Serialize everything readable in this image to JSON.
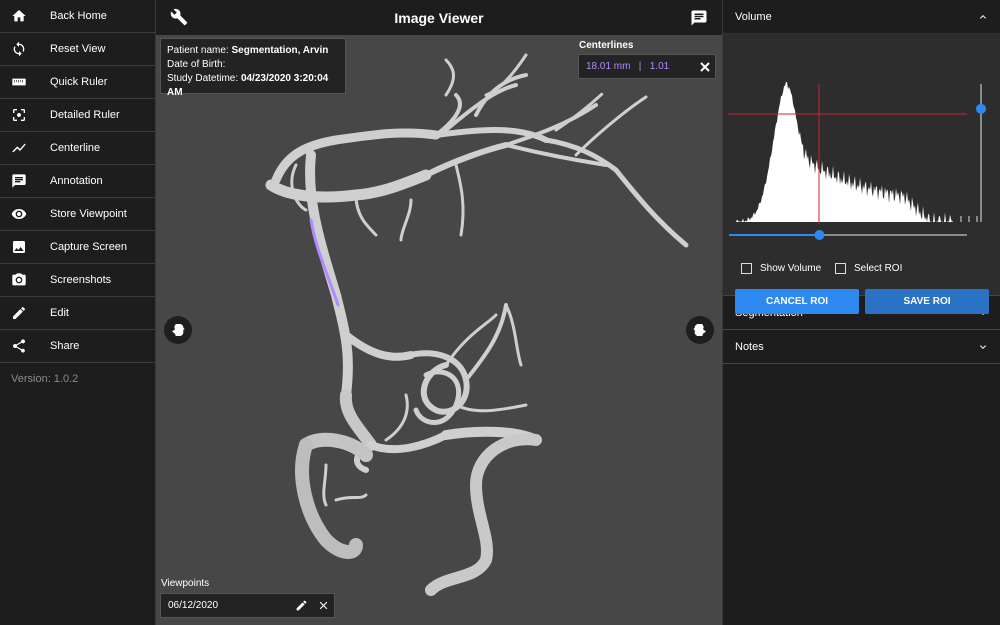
{
  "sidebar": {
    "items": [
      {
        "label": "Back Home",
        "icon": "home-icon"
      },
      {
        "label": "Reset View",
        "icon": "sync-icon"
      },
      {
        "label": "Quick Ruler",
        "icon": "ruler-icon"
      },
      {
        "label": "Detailed Ruler",
        "icon": "focus-icon"
      },
      {
        "label": "Centerline",
        "icon": "line-chart-icon"
      },
      {
        "label": "Annotation",
        "icon": "chat-icon"
      },
      {
        "label": "Store Viewpoint",
        "icon": "eye-icon"
      },
      {
        "label": "Capture Screen",
        "icon": "image-icon"
      },
      {
        "label": "Screenshots",
        "icon": "camera-icon"
      },
      {
        "label": "Edit",
        "icon": "pencil-icon"
      },
      {
        "label": "Share",
        "icon": "share-icon"
      }
    ],
    "version": "Version: 1.0.2"
  },
  "viewer": {
    "title": "Image Viewer",
    "patient": {
      "name_label": "Patient name:",
      "name_value": "Segmentation, Arvin",
      "dob_label": "Date of Birth:",
      "study_label": "Study Datetime:",
      "study_value": "04/23/2020 3:20:04 AM"
    },
    "centerlines": {
      "label": "Centerlines",
      "values": "18.01 mm   |   1.01",
      "value_color": "#b18aff"
    },
    "viewpoints": {
      "label": "Viewpoints",
      "date": "06/12/2020"
    }
  },
  "panel": {
    "volume_title": "Volume",
    "show_volume_label": "Show Volume",
    "select_roi_label": "Select ROI",
    "cancel_label": "CANCEL ROI",
    "save_label": "SAVE ROI",
    "segmentation_title": "Segmentation",
    "notes_title": "Notes",
    "accent_color": "#2d89ef",
    "crosshair_color": "#d0213a",
    "vertical_slider_level": 0.82,
    "horizontal_slider_level": 0.38
  }
}
